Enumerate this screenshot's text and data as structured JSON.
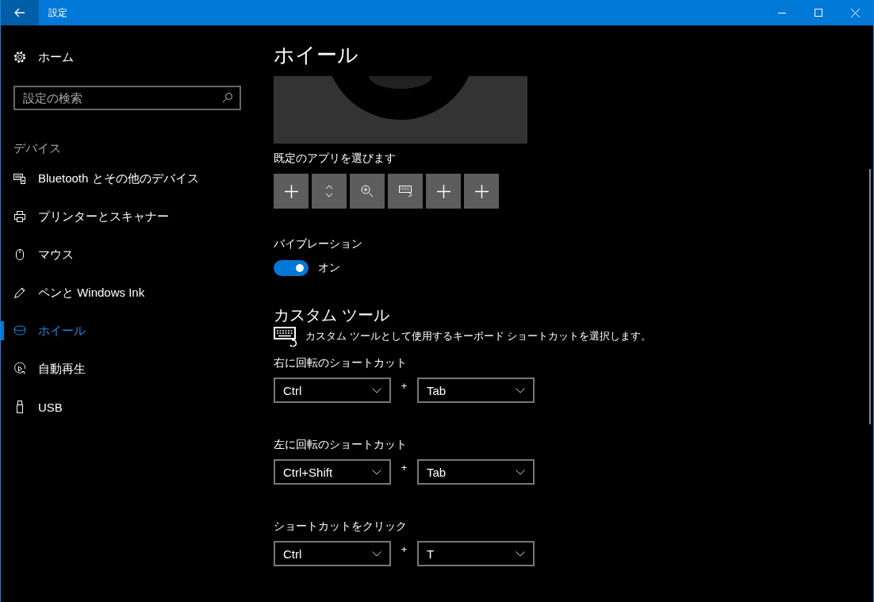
{
  "window": {
    "title": "設定"
  },
  "sidebar": {
    "home": "ホーム",
    "search": {
      "placeholder": "設定の検索"
    },
    "section": "デバイス",
    "items": [
      {
        "label": "Bluetooth とその他のデバイス",
        "kind": "bluetooth",
        "selected": false
      },
      {
        "label": "プリンターとスキャナー",
        "kind": "printer",
        "selected": false
      },
      {
        "label": "マウス",
        "kind": "mouse",
        "selected": false
      },
      {
        "label": "ペンと Windows Ink",
        "kind": "pen",
        "selected": false
      },
      {
        "label": "ホイール",
        "kind": "wheel",
        "selected": true
      },
      {
        "label": "自動再生",
        "kind": "autoplay",
        "selected": false
      },
      {
        "label": "USB",
        "kind": "usb",
        "selected": false
      }
    ]
  },
  "page": {
    "title": "ホイール",
    "apps_label": "既定のアプリを選びます",
    "app_buttons": [
      {
        "kind": "plus"
      },
      {
        "kind": "updown"
      },
      {
        "kind": "zoom"
      },
      {
        "kind": "keyboard"
      },
      {
        "kind": "plus"
      },
      {
        "kind": "plus"
      }
    ],
    "vibration": {
      "label": "バイブレーション",
      "on": true,
      "state": "オン"
    },
    "custom_tool": {
      "heading": "カスタム ツール",
      "description": "カスタム ツールとして使用するキーボード ショートカットを選択します。"
    },
    "shortcuts": [
      {
        "label": "右に回転のショートカット",
        "modifier": "Ctrl",
        "plus": "+",
        "key": "Tab"
      },
      {
        "label": "左に回転のショートカット",
        "modifier": "Ctrl+Shift",
        "plus": "+",
        "key": "Tab"
      },
      {
        "label": "ショートカットをクリック",
        "modifier": "Ctrl",
        "plus": "+",
        "key": "T"
      }
    ]
  }
}
